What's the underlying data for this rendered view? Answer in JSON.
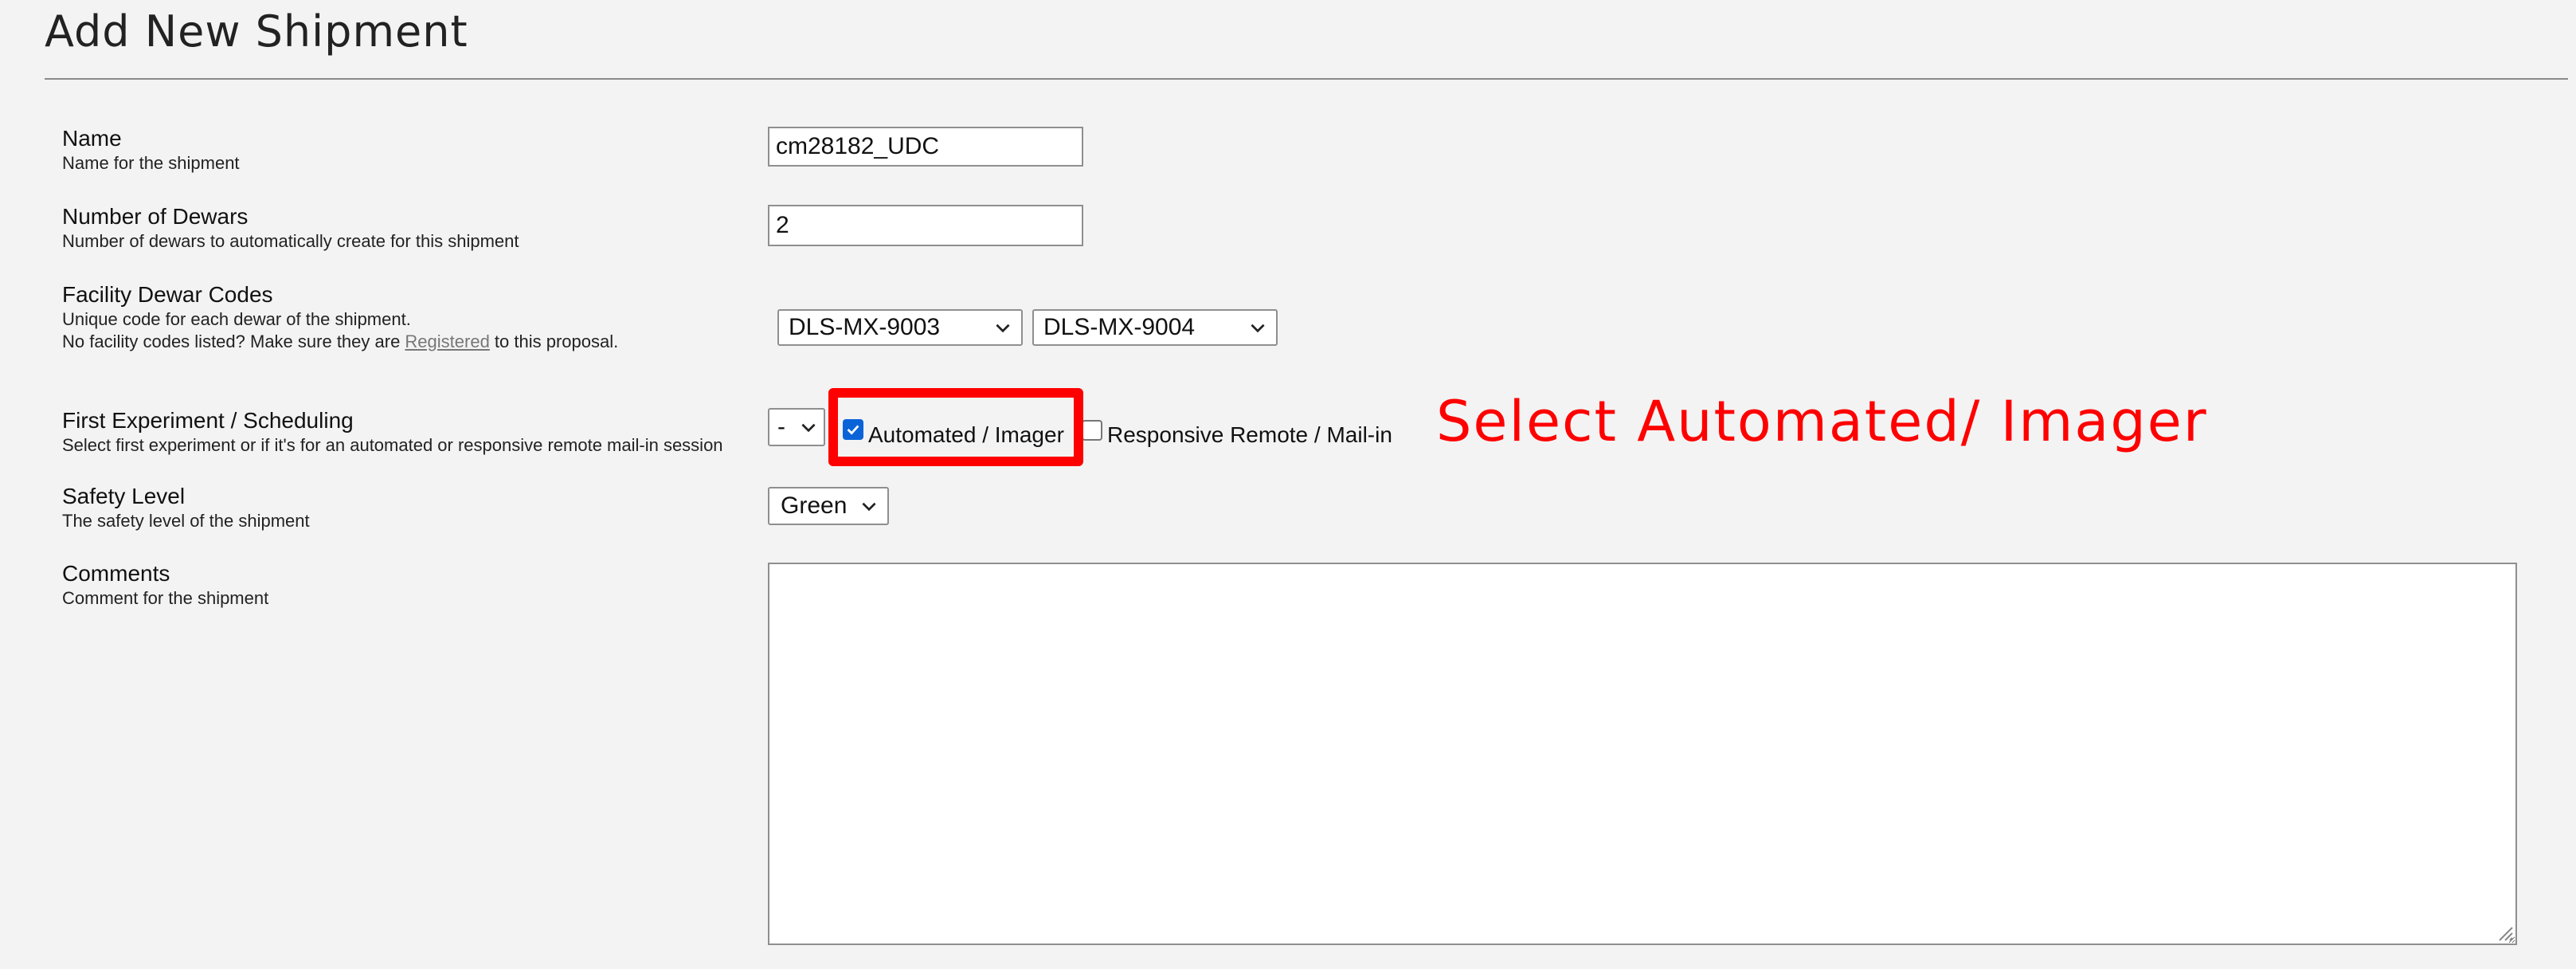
{
  "page": {
    "title": "Add New Shipment"
  },
  "form": {
    "name": {
      "label": "Name",
      "description": "Name for the shipment",
      "value": "cm28182_UDC"
    },
    "dewars": {
      "label": "Number of Dewars",
      "description": "Number of dewars to automatically create for this shipment",
      "value": "2"
    },
    "facility_codes": {
      "label": "Facility Dewar Codes",
      "description_line1": "Unique code for each dewar of the shipment.",
      "description_line2_prefix": "No facility codes listed? Make sure they are ",
      "description_link": "Registered",
      "description_line2_suffix": " to this proposal.",
      "selects": [
        "DLS-MX-9003",
        "DLS-MX-9004"
      ]
    },
    "first_experiment": {
      "label": "First Experiment / Scheduling",
      "description": "Select first experiment or if it's for an automated or responsive remote mail-in session",
      "select_value": "-",
      "automated_label": "Automated / Imager",
      "automated_checked": true,
      "responsive_label": "Responsive Remote / Mail-in",
      "responsive_checked": false
    },
    "safety": {
      "label": "Safety Level",
      "description": "The safety level of the shipment",
      "value": "Green"
    },
    "comments": {
      "label": "Comments",
      "description": "Comment for the shipment",
      "value": ""
    }
  },
  "annotation": {
    "text": "Select Automated/ Imager",
    "color": "#ff0000"
  },
  "icons": {
    "select_chevron": "chevron-down-icon",
    "checkmark": "checkmark-icon",
    "resize": "resize-grip-icon"
  }
}
